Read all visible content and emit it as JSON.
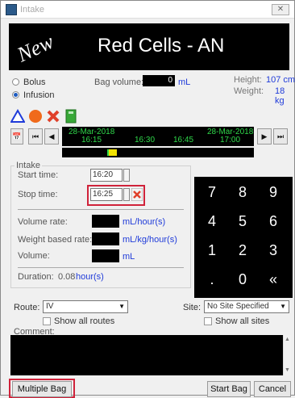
{
  "window": {
    "title": "Intake"
  },
  "banner": {
    "status": "New",
    "product": "Red Cells - AN"
  },
  "mode": {
    "bolus_label": "Bolus",
    "infusion_label": "Infusion",
    "selected": "Infusion"
  },
  "bag_volume": {
    "label": "Bag volume:",
    "value": "0",
    "unit": "mL"
  },
  "patient": {
    "height_label": "Height:",
    "height_value": "107 cm",
    "weight_label": "Weight:",
    "weight_value": "18 kg"
  },
  "timeline": {
    "start_date": "28-Mar-2018",
    "start_time": "16:15",
    "ticks": [
      "16:30",
      "16:45"
    ],
    "end_date": "28-Mar-2018",
    "end_time": "17:00"
  },
  "intake": {
    "legend": "Intake",
    "start_label": "Start time:",
    "start_value": "16:20",
    "stop_label": "Stop time:",
    "stop_value": "16:25",
    "volume_rate_label": "Volume rate:",
    "volume_rate_unit": "mL/hour(s)",
    "weight_rate_label": "Weight based rate:",
    "weight_rate_unit": "mL/kg/hour(s)",
    "volume_label": "Volume:",
    "volume_unit": "mL",
    "duration_label": "Duration:",
    "duration_value": "0.08",
    "duration_unit": "hour(s)"
  },
  "keypad": {
    "keys": [
      "7",
      "8",
      "9",
      "4",
      "5",
      "6",
      "1",
      "2",
      "3",
      ".",
      "0",
      "«"
    ]
  },
  "route": {
    "label": "Route:",
    "value": "IV",
    "show_all_label": "Show all routes"
  },
  "site": {
    "label": "Site:",
    "value": "No Site Specified",
    "show_all_label": "Show all sites"
  },
  "comment": {
    "label": "Comment:"
  },
  "buttons": {
    "multiple_bag": "Multiple Bag",
    "start_bag": "Start Bag",
    "cancel": "Cancel"
  },
  "colors": {
    "accent_blue": "#1f3bd9",
    "timeline_green": "#2fd84a",
    "highlight_red": "#d0223a"
  }
}
